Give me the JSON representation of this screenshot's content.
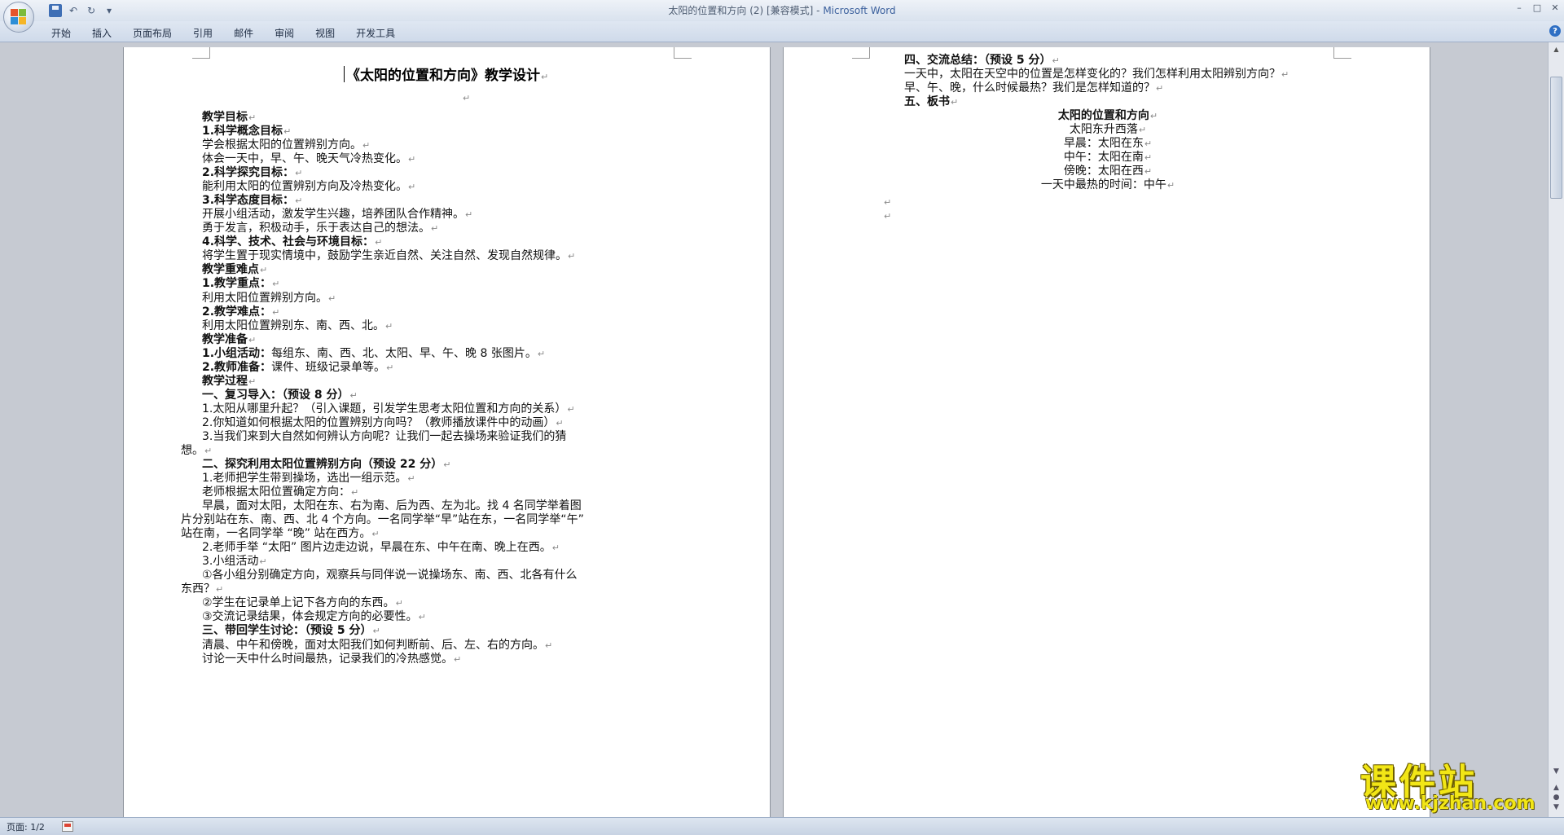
{
  "window": {
    "title_doc": "太阳的位置和方向 (2) [兼容模式] - ",
    "title_app": "Microsoft Word",
    "controls": {
      "minimize": "–",
      "maximize": "□",
      "close": "✕"
    }
  },
  "quick_access": {
    "undo": "↶",
    "redo": "↻",
    "more": "▾"
  },
  "ribbon": {
    "tabs": [
      "开始",
      "插入",
      "页面布局",
      "引用",
      "邮件",
      "审阅",
      "视图",
      "开发工具"
    ],
    "help": "?"
  },
  "paragraph_mark": "↵",
  "page1": {
    "title": "《太阳的位置和方向》教学设计",
    "lines": [
      {
        "text": "教学目标",
        "bold": true
      },
      {
        "text": "1.科学概念目标",
        "bold": true
      },
      {
        "text": "学会根据太阳的位置辨别方向。",
        "bold": false
      },
      {
        "text": "体会一天中，早、午、晚天气冷热变化。",
        "bold": false
      },
      {
        "text": "2.科学探究目标：",
        "bold": true
      },
      {
        "text": "能利用太阳的位置辨别方向及冷热变化。",
        "bold": false
      },
      {
        "text": "3.科学态度目标：",
        "bold": true
      },
      {
        "text": "开展小组活动，激发学生兴趣，培养团队合作精神。",
        "bold": false
      },
      {
        "text": "勇于发言，积极动手，乐于表达自己的想法。",
        "bold": false
      },
      {
        "text": "4.科学、技术、社会与环境目标：",
        "bold": true
      },
      {
        "text": "将学生置于现实情境中，鼓励学生亲近自然、关注自然、发现自然规律。",
        "bold": false
      },
      {
        "text": "教学重难点",
        "bold": true
      },
      {
        "text": "1.教学重点：",
        "bold": true
      },
      {
        "text": "利用太阳位置辨别方向。",
        "bold": false
      },
      {
        "text": "2.教学难点：",
        "bold": true
      },
      {
        "text": "利用太阳位置辨别东、南、西、北。",
        "bold": false
      },
      {
        "text": "教学准备",
        "bold": true
      },
      {
        "text": "1.小组活动：每组东、南、西、北、太阳、早、午、晚 8 张图片。",
        "bold": false,
        "lead": "1.小组活动："
      },
      {
        "text": "2.教师准备：课件、班级记录单等。",
        "bold": false,
        "lead": "2.教师准备："
      },
      {
        "text": "教学过程",
        "bold": true
      },
      {
        "text": "一、复习导入：（预设 8 分）",
        "bold": true
      },
      {
        "text": "1.太阳从哪里升起？（引入课题，引发学生思考太阳位置和方向的关系）",
        "bold": false
      },
      {
        "text": "2.你知道如何根据太阳的位置辨别方向吗？（教师播放课件中的动画）",
        "bold": false
      },
      {
        "text": "3.当我们来到大自然如何辨认方向呢？让我们一起去操场来验证我们的猜",
        "bold": false,
        "nomark": true
      },
      {
        "text": "想。",
        "bold": false,
        "indent": "hang"
      },
      {
        "text": "二、探究利用太阳位置辨别方向（预设 22 分）",
        "bold": true
      },
      {
        "text": "1.老师把学生带到操场，选出一组示范。",
        "bold": false
      },
      {
        "text": "老师根据太阳位置确定方向：",
        "bold": false
      },
      {
        "text": "早晨，面对太阳，太阳在东、右为南、后为西、左为北。找 4 名同学举着图",
        "bold": false,
        "nomark": true
      },
      {
        "text": "片分别站在东、南、西、北 4 个方向。一名同学举“早”站在东，一名同学举“午”",
        "bold": false,
        "indent": "hang",
        "nomark": true
      },
      {
        "text": "站在南，一名同学举 “晚” 站在西方。",
        "bold": false,
        "indent": "hang"
      },
      {
        "text": "2.老师手举 “太阳” 图片边走边说，早晨在东、中午在南、晚上在西。",
        "bold": false
      },
      {
        "text": "3.小组活动",
        "bold": false
      },
      {
        "text": "①各小组分别确定方向，观察兵与同伴说一说操场东、南、西、北各有什么",
        "bold": false,
        "nomark": true
      },
      {
        "text": "东西？",
        "bold": false,
        "indent": "hang"
      },
      {
        "text": "②学生在记录单上记下各方向的东西。",
        "bold": false
      },
      {
        "text": "③交流记录结果，体会规定方向的必要性。",
        "bold": false
      },
      {
        "text": "三、带回学生讨论：（预设 5 分）",
        "bold": true
      },
      {
        "text": "清晨、中午和傍晚，面对太阳我们如何判断前、后、左、右的方向。",
        "bold": false
      },
      {
        "text": "讨论一天中什么时间最热，记录我们的冷热感觉。",
        "bold": false
      }
    ]
  },
  "page2": {
    "lines": [
      {
        "text": "四、交流总结：（预设 5 分）",
        "bold": true
      },
      {
        "text": "一天中，太阳在天空中的位置是怎样变化的？我们怎样利用太阳辨别方向？",
        "bold": false
      },
      {
        "text": "早、午、晚，什么时候最热？我们是怎样知道的？",
        "bold": false
      },
      {
        "text": "五、板书",
        "bold": true
      }
    ],
    "board": [
      {
        "text": "太阳的位置和方向",
        "bold": true
      },
      {
        "text": "太阳东升西落",
        "bold": false
      },
      {
        "text": "早晨：太阳在东",
        "bold": false
      },
      {
        "text": "中午：太阳在南",
        "bold": false
      },
      {
        "text": "傍晚：太阳在西",
        "bold": false
      },
      {
        "text": "一天中最热的时间：中午",
        "bold": false
      }
    ]
  },
  "status": {
    "page": "页面: 1/2"
  },
  "watermark": {
    "cn": "课件站",
    "url": "www.kjzhan.com"
  }
}
